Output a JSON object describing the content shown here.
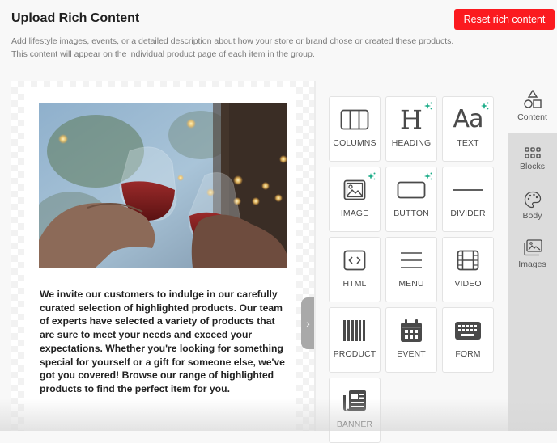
{
  "header": {
    "title": "Upload Rich Content",
    "description_line1": "Add lifestyle images, events, or a detailed description about how your store or brand chose or created these products.",
    "description_line2": "This content will appear on the individual product page of each item in the group.",
    "reset_label": "Reset rich content"
  },
  "colors": {
    "accent": "#fb1a1f",
    "sparkle": "#1fae8a",
    "icon": "#4a4a4a"
  },
  "canvas": {
    "image_alt": "Two glasses of red wine clinking under string lights",
    "body_text": " We invite our customers to indulge in our carefully curated selection of highlighted products. Our team of experts have selected a variety of products that are sure to meet your needs and exceed your expectations. Whether you're looking for something special for yourself or a gift for someone else, we've got you covered! Browse our range of highlighted products to find the perfect item for you.",
    "collapse_icon": "chevron-right-icon"
  },
  "tools": [
    {
      "label": "COLUMNS",
      "icon": "columns-icon",
      "ai": false
    },
    {
      "label": "HEADING",
      "icon": "heading-icon",
      "ai": true
    },
    {
      "label": "TEXT",
      "icon": "text-icon",
      "ai": true
    },
    {
      "label": "IMAGE",
      "icon": "image-icon",
      "ai": true
    },
    {
      "label": "BUTTON",
      "icon": "button-icon",
      "ai": true
    },
    {
      "label": "DIVIDER",
      "icon": "divider-icon",
      "ai": false
    },
    {
      "label": "HTML",
      "icon": "html-icon",
      "ai": false
    },
    {
      "label": "MENU",
      "icon": "menu-icon",
      "ai": false
    },
    {
      "label": "VIDEO",
      "icon": "video-icon",
      "ai": false
    },
    {
      "label": "PRODUCT",
      "icon": "barcode-icon",
      "ai": false
    },
    {
      "label": "EVENT",
      "icon": "calendar-icon",
      "ai": false
    },
    {
      "label": "FORM",
      "icon": "keyboard-icon",
      "ai": false
    },
    {
      "label": "BANNER",
      "icon": "newspaper-icon",
      "ai": false
    }
  ],
  "rail": [
    {
      "label": "Content",
      "icon": "shapes-icon",
      "active": true
    },
    {
      "label": "Blocks",
      "icon": "blocks-icon",
      "active": false
    },
    {
      "label": "Body",
      "icon": "palette-icon",
      "active": false
    },
    {
      "label": "Images",
      "icon": "images-icon",
      "active": false
    }
  ]
}
